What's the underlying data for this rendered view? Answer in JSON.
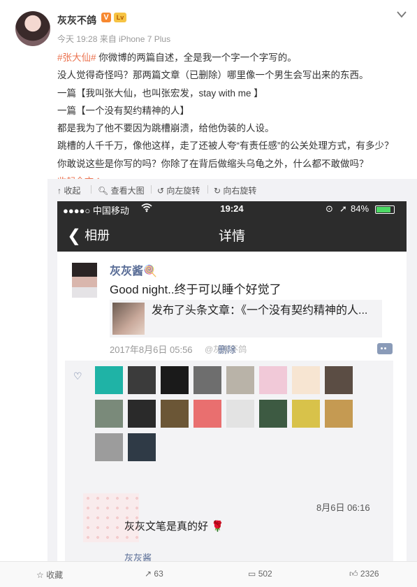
{
  "post": {
    "author": "灰灰不鸽",
    "verified_badge": "V",
    "level_badge": "Lv",
    "meta": "今天 19:28 来自 iPhone 7 Plus",
    "hashtag": "#张大仙#",
    "lines": [
      " 你微博的两篇自述，全是我一个字一个字写的。",
      "没人觉得奇怪吗？那两篇文章（已删除）哪里像一个男生会写出来的东西。",
      "一篇【我叫张大仙，也叫张宏发，stay with me 】",
      "一篇【一个没有契约精神的人】",
      "都是我为了他不要因为跳槽崩溃，给他伪装的人设。",
      "跳槽的人千千万，像他这样，走了还被人夸“有责任感”的公关处理方式，有多少？",
      "你敢说这些是你写的吗？你除了在背后做缩头乌龟之外，什么都不敢做吗？"
    ],
    "collapse_label": "收起全文 ^"
  },
  "image_toolbar": {
    "collect": "↑ 收起",
    "view_large": "查看大图",
    "rotate_left": "向左旋转",
    "rotate_right": "向右旋转"
  },
  "screenshot": {
    "status": {
      "signal": "●●●●○ 中国移动",
      "wifi": "wifi",
      "time": "19:24",
      "battery": "84%"
    },
    "nav": {
      "back": "相册",
      "title": "详情"
    },
    "moment": {
      "name": "灰灰酱🍭",
      "text": "Good night..终于可以睡个好觉了",
      "shared_title": "发布了头条文章：《一个没有契约精神的人...",
      "time": "2017年8月6日 05:56",
      "delete": "删除",
      "watermark": "@灰灰不鸽"
    },
    "comment": {
      "time": "8月6日 06:16",
      "text": "灰灰文笔是真的好 🌹",
      "next_name": "灰灰酱"
    }
  },
  "bottom_bar": {
    "favorite": "收藏",
    "repost_count": "63",
    "comment_count": "502",
    "like_count": "2326"
  },
  "colors": {
    "hashtag": "#eb7350",
    "wechat_link": "#576b95"
  }
}
